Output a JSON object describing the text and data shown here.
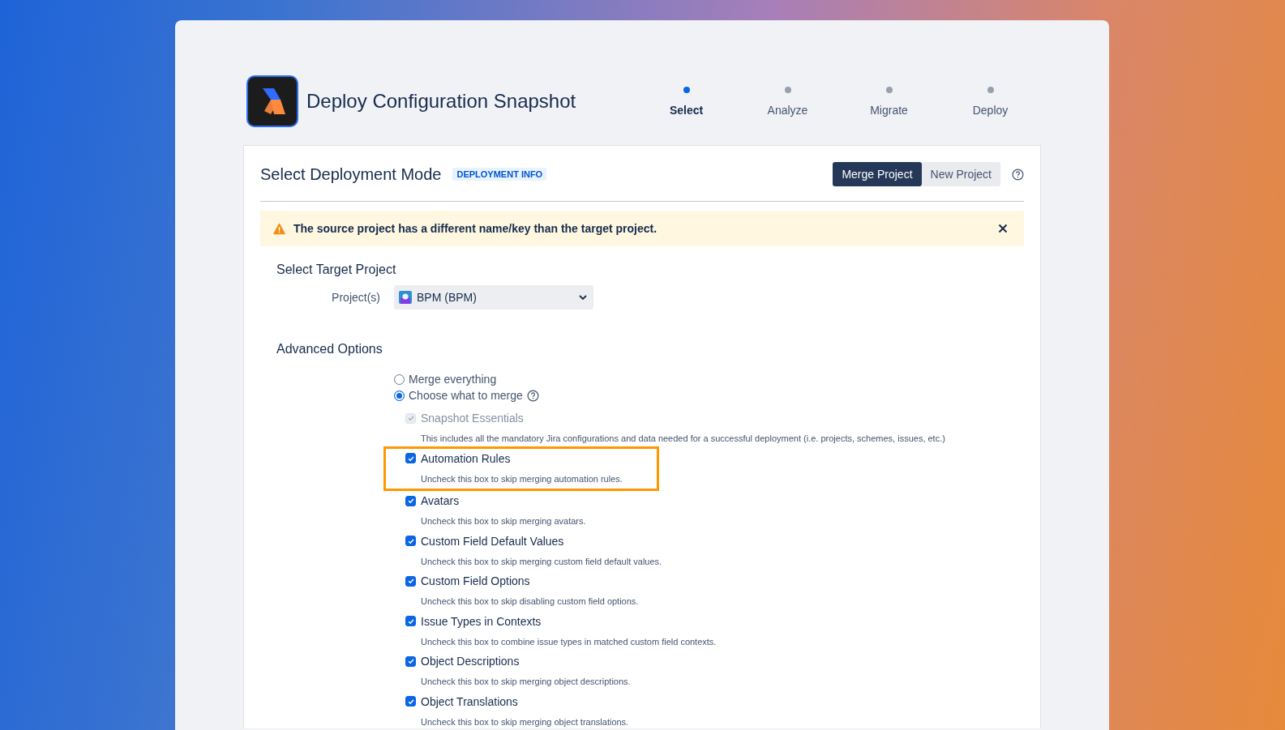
{
  "header": {
    "title": "Deploy Configuration Snapshot"
  },
  "steps": [
    {
      "label": "Select",
      "selected": true
    },
    {
      "label": "Analyze",
      "selected": false
    },
    {
      "label": "Migrate",
      "selected": false
    },
    {
      "label": "Deploy",
      "selected": false
    }
  ],
  "panel": {
    "title": "Select Deployment Mode",
    "badge": "DEPLOYMENT INFO",
    "mode_buttons": [
      {
        "label": "Merge Project",
        "selected": true
      },
      {
        "label": "New Project",
        "selected": false
      }
    ]
  },
  "warning": {
    "message": "The source project has a different name/key than the target project."
  },
  "target": {
    "heading": "Select Target Project",
    "label": "Project(s)",
    "value": "BPM (BPM)"
  },
  "advanced": {
    "heading": "Advanced Options",
    "radios": [
      {
        "label": "Merge everything",
        "selected": false,
        "help": false
      },
      {
        "label": "Choose what to merge",
        "selected": true,
        "help": true
      }
    ],
    "options": [
      {
        "label": "Snapshot Essentials",
        "description": "This includes all the mandatory Jira configurations and data needed for a successful deployment (i.e. projects, schemes, issues, etc.)",
        "checked": true,
        "disabled": true,
        "highlighted": false
      },
      {
        "label": "Automation Rules",
        "description": "Uncheck this box to skip merging automation rules.",
        "checked": true,
        "disabled": false,
        "highlighted": true
      },
      {
        "label": "Avatars",
        "description": "Uncheck this box to skip merging avatars.",
        "checked": true,
        "disabled": false,
        "highlighted": false
      },
      {
        "label": "Custom Field Default Values",
        "description": "Uncheck this box to skip merging custom field default values.",
        "checked": true,
        "disabled": false,
        "highlighted": false
      },
      {
        "label": "Custom Field Options",
        "description": "Uncheck this box to skip disabling custom field options.",
        "checked": true,
        "disabled": false,
        "highlighted": false
      },
      {
        "label": "Issue Types in Contexts",
        "description": "Uncheck this box to combine issue types in matched custom field contexts.",
        "checked": true,
        "disabled": false,
        "highlighted": false
      },
      {
        "label": "Object Descriptions",
        "description": "Uncheck this box to skip merging object descriptions.",
        "checked": true,
        "disabled": false,
        "highlighted": false
      },
      {
        "label": "Object Translations",
        "description": "Uncheck this box to skip merging object translations.",
        "checked": true,
        "disabled": false,
        "highlighted": false
      }
    ]
  }
}
